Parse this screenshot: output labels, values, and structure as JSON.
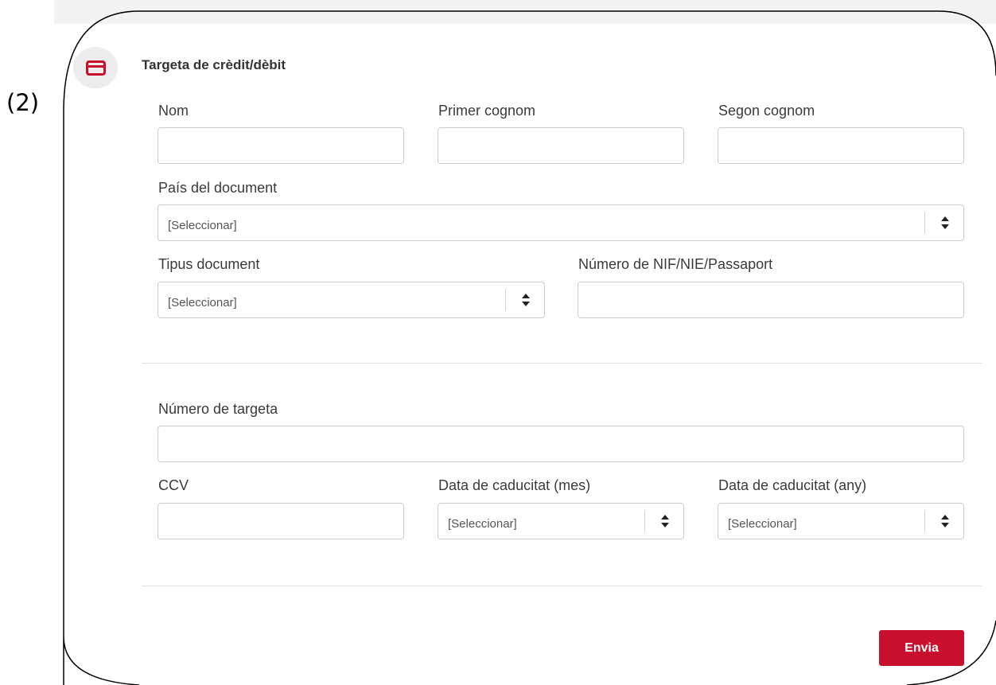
{
  "annotation_label": "(2)",
  "section": {
    "title": "Targeta de crèdit/dèbit",
    "icon": "credit-card-icon"
  },
  "fields": {
    "nom": {
      "label": "Nom",
      "value": ""
    },
    "primer_cognom": {
      "label": "Primer cognom",
      "value": ""
    },
    "segon_cognom": {
      "label": "Segon cognom",
      "value": ""
    },
    "pais_document": {
      "label": "País del document",
      "selected": "[Seleccionar]"
    },
    "tipus_document": {
      "label": "Tipus document",
      "selected": "[Seleccionar]"
    },
    "numero_document": {
      "label": "Número de NIF/NIE/Passaport",
      "value": ""
    },
    "numero_targeta": {
      "label": "Número de targeta",
      "value": ""
    },
    "ccv": {
      "label": "CCV",
      "value": ""
    },
    "caducitat_mes": {
      "label": "Data de caducitat (mes)",
      "selected": "[Seleccionar]"
    },
    "caducitat_any": {
      "label": "Data de caducitat (any)",
      "selected": "[Seleccionar]"
    }
  },
  "submit_label": "Envia",
  "colors": {
    "accent": "#c8102e",
    "border": "#cccccc",
    "label_text": "#3a3a3a",
    "icon_circle": "#ececec"
  }
}
